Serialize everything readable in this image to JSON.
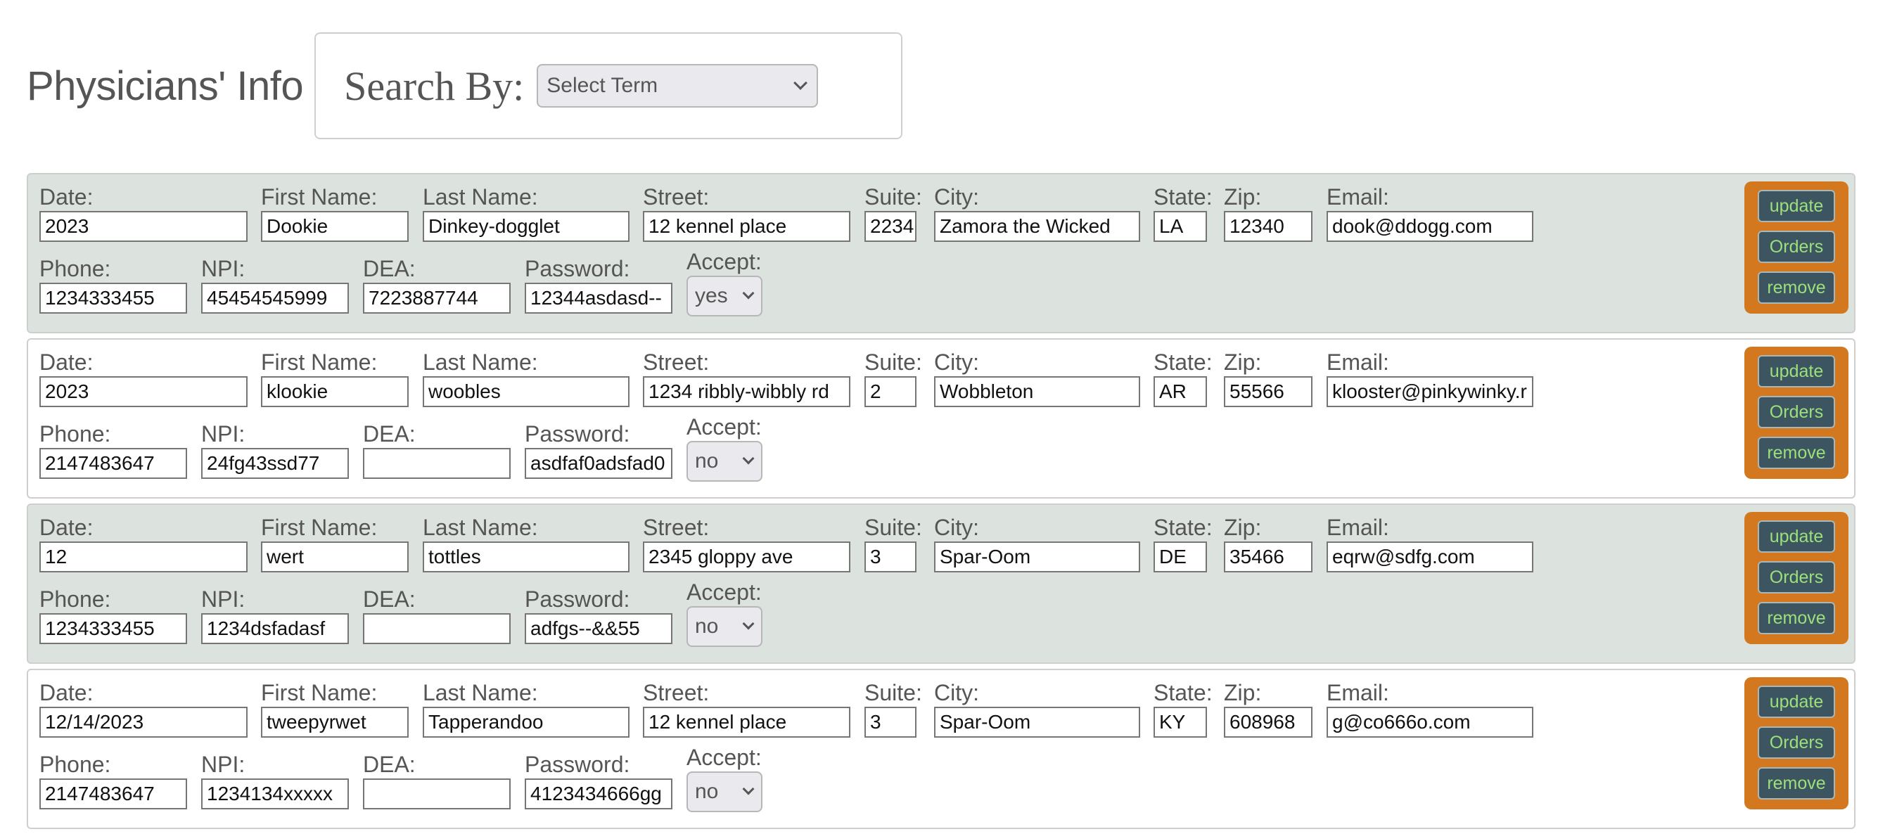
{
  "header": {
    "title": "Physicians' Info",
    "search_label": "Search By:",
    "search_select_value": "Select Term"
  },
  "labels": {
    "date": "Date:",
    "first_name": "First Name:",
    "last_name": "Last Name:",
    "street": "Street:",
    "suite": "Suite:",
    "city": "City:",
    "state": "State:",
    "zip": "Zip:",
    "email": "Email:",
    "phone": "Phone:",
    "npi": "NPI:",
    "dea": "DEA:",
    "password": "Password:",
    "accept": "Accept:"
  },
  "buttons": {
    "update": "update",
    "orders": "Orders",
    "remove": "remove"
  },
  "records": [
    {
      "date": "2023",
      "first_name": "Dookie",
      "last_name": "Dinkey-dogglet",
      "street": "12 kennel place",
      "suite": "2234",
      "city": "Zamora the Wicked",
      "state": "LA",
      "zip": "12340",
      "email": "dook@ddogg.com",
      "phone": "1234333455",
      "npi": "45454545999",
      "dea": "7223887744",
      "password": "12344asdasd--",
      "accept": "yes"
    },
    {
      "date": "2023",
      "first_name": "klookie",
      "last_name": "woobles",
      "street": "1234 ribbly-wibbly rd",
      "suite": "2",
      "city": "Wobbleton",
      "state": "AR",
      "zip": "55566",
      "email": "klooster@pinkywinky.r",
      "phone": "2147483647",
      "npi": "24fg43ssd77",
      "dea": "",
      "password": "asdfaf0adsfad0",
      "accept": "no"
    },
    {
      "date": "12",
      "first_name": "wert",
      "last_name": "tottles",
      "street": "2345 gloppy ave",
      "suite": "3",
      "city": "Spar-Oom",
      "state": "DE",
      "zip": "35466",
      "email": "eqrw@sdfg.com",
      "phone": "1234333455",
      "npi": "1234dsfadasf",
      "dea": "",
      "password": "adfgs--&&55",
      "accept": "no"
    },
    {
      "date": "12/14/2023",
      "first_name": "tweepyrwet",
      "last_name": "Tapperandoo",
      "street": "12 kennel place",
      "suite": "3",
      "city": "Spar-Oom",
      "state": "KY",
      "zip": "608968",
      "email": "g@co666o.com",
      "phone": "2147483647",
      "npi": "1234134xxxxx",
      "dea": "",
      "password": "4123434666gg",
      "accept": "no"
    }
  ]
}
